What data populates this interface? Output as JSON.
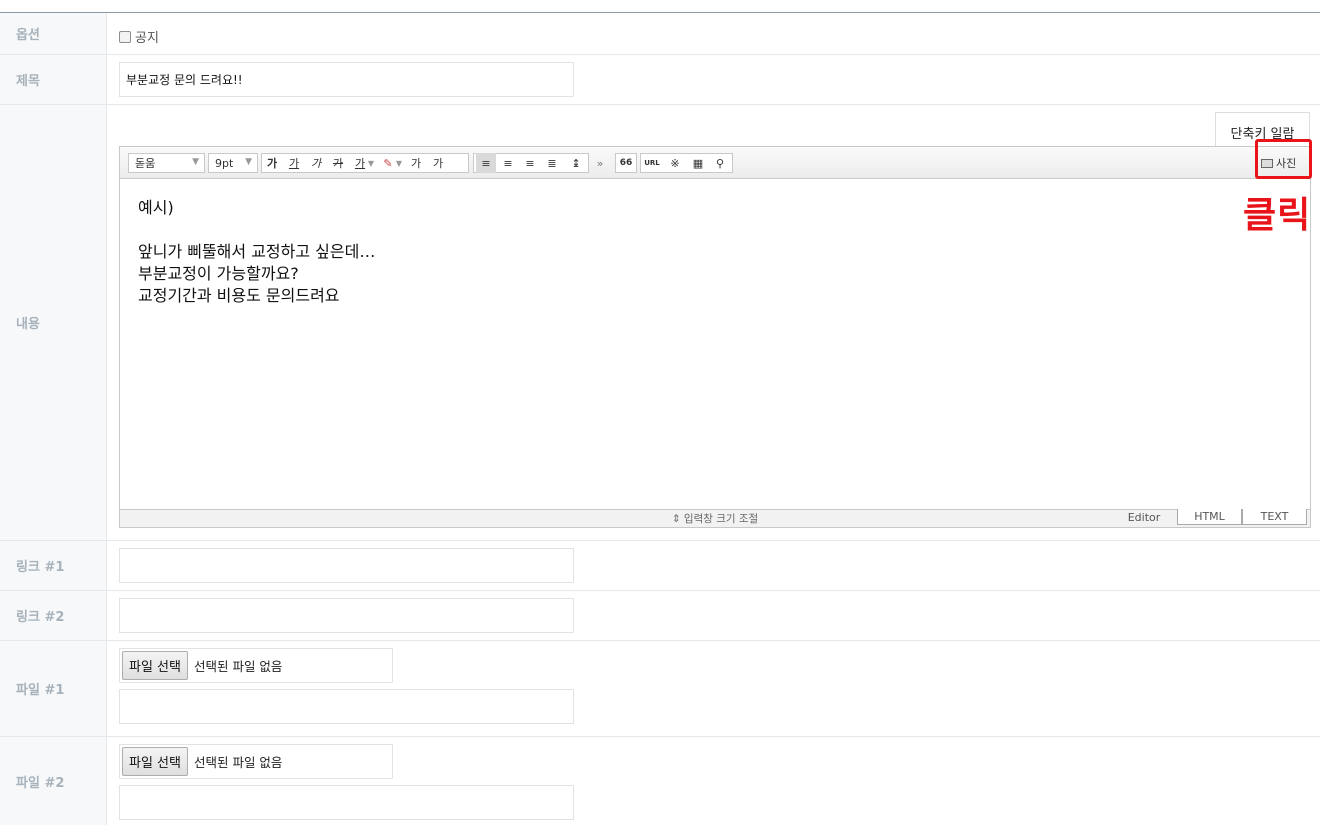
{
  "rows": {
    "option": {
      "label": "옵션",
      "checkbox_label": "공지"
    },
    "subject": {
      "label": "제목",
      "value": "부분교정 문의 드려요!!"
    },
    "content": {
      "label": "내용"
    },
    "link1": {
      "label": "링크 #1",
      "value": ""
    },
    "link2": {
      "label": "링크 #2",
      "value": ""
    },
    "file1": {
      "label": "파일 #1",
      "button": "파일 선택",
      "status": "선택된 파일 없음"
    },
    "file2": {
      "label": "파일 #2",
      "button": "파일 선택",
      "status": "선택된 파일 없음"
    }
  },
  "editor": {
    "shortcut_button": "단축키 일람",
    "font_select": "돋움",
    "size_select": "9pt",
    "toolbar": {
      "bold": "가",
      "underline": "가",
      "italic": "가",
      "strike": "가",
      "font_color": "가",
      "superscript": "가",
      "subscript": "가",
      "more": "»",
      "quote": "66",
      "url": "URL",
      "special_char": "※"
    },
    "photo_button": "사진",
    "annotation": "클릭",
    "body_lines": [
      "예시)",
      "",
      "앞니가 삐뚤해서 교정하고 싶은데…",
      "부분교정이 가능할까요?",
      "교정기간과 비용도 문의드려요"
    ],
    "resize_label": "⇕ 입력창 크기 조절",
    "modes": [
      "Editor",
      "HTML",
      "TEXT"
    ]
  },
  "colors": {
    "annotation": "#e8141a",
    "label": "#a7b2bb",
    "label_bg": "#f6f8f9"
  }
}
